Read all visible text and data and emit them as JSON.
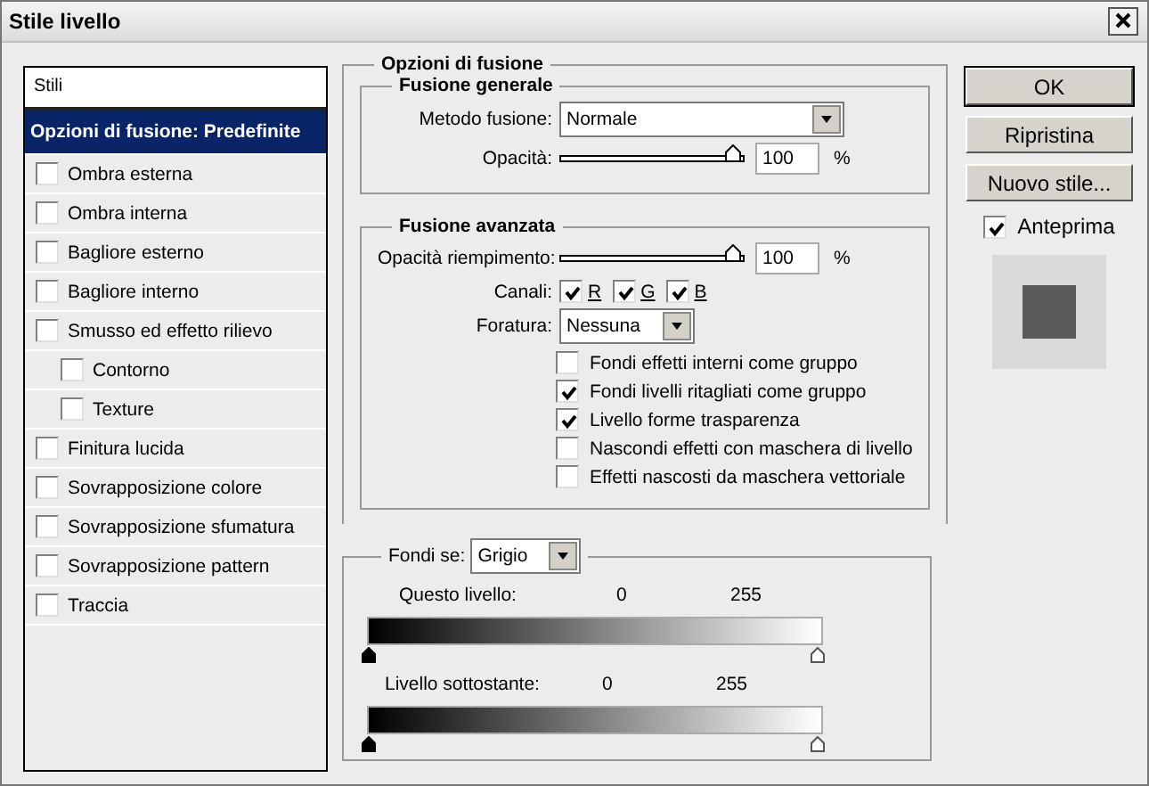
{
  "window": {
    "title": "Stile livello"
  },
  "styles_list": {
    "header": "Stili",
    "items": [
      {
        "label": "Opzioni di fusione: Predefinite",
        "kind": "heading",
        "selected": true
      },
      {
        "label": "Ombra esterna",
        "kind": "check",
        "checked": false,
        "selected": false
      },
      {
        "label": "Ombra interna",
        "kind": "check",
        "checked": false,
        "selected": false
      },
      {
        "label": "Bagliore esterno",
        "kind": "check",
        "checked": false,
        "selected": false
      },
      {
        "label": "Bagliore interno",
        "kind": "check",
        "checked": false,
        "selected": false
      },
      {
        "label": "Smusso ed effetto rilievo",
        "kind": "check",
        "checked": false,
        "selected": false,
        "children": [
          {
            "label": "Contorno",
            "kind": "check",
            "checked": false,
            "selected": false
          },
          {
            "label": "Texture",
            "kind": "check",
            "checked": false,
            "selected": false
          }
        ]
      },
      {
        "label": "Finitura lucida",
        "kind": "check",
        "checked": false,
        "selected": false
      },
      {
        "label": "Sovrapposizione colore",
        "kind": "check",
        "checked": false,
        "selected": false
      },
      {
        "label": "Sovrapposizione sfumatura",
        "kind": "check",
        "checked": false,
        "selected": false
      },
      {
        "label": "Sovrapposizione pattern",
        "kind": "check",
        "checked": false,
        "selected": false
      },
      {
        "label": "Traccia",
        "kind": "check",
        "checked": false,
        "selected": false
      }
    ]
  },
  "blending": {
    "title": "Opzioni di fusione",
    "general": {
      "title": "Fusione generale",
      "mode_label": "Metodo fusione:",
      "mode": "Normale",
      "opacity_label": "Opacità:",
      "opacity": {
        "level": 1,
        "value": "100",
        "unit": "%"
      }
    },
    "advanced": {
      "title": "Fusione avanzata",
      "fill_label": "Opacità riempimento:",
      "fill": {
        "level": 1,
        "value": "100",
        "unit": "%"
      },
      "channels_label": "Canali:",
      "channels": [
        {
          "label": "R",
          "checked": true
        },
        {
          "label": "G",
          "checked": true
        },
        {
          "label": "B",
          "checked": true
        }
      ],
      "knockout_label": "Foratura:",
      "knockout": "Nessuna",
      "options": [
        {
          "label": "Fondi effetti interni come gruppo",
          "checked": false
        },
        {
          "label": "Fondi livelli ritagliati come gruppo",
          "checked": true
        },
        {
          "label": "Livello forme trasparenza",
          "checked": true
        },
        {
          "label": "Nascondi effetti con maschera di livello",
          "checked": false
        },
        {
          "label": "Effetti nascosti da maschera vettoriale",
          "checked": false
        }
      ]
    },
    "blend_if": {
      "label": "Fondi se:",
      "channel": "Grigio",
      "ranges": [
        {
          "label": "Questo livello:",
          "low": "0",
          "high": "255"
        },
        {
          "label": "Livello sottostante:",
          "low": "0",
          "high": "255"
        }
      ]
    }
  },
  "buttons": [
    {
      "label": "OK",
      "default": true
    },
    {
      "label": "Ripristina",
      "default": false
    },
    {
      "label": "Nuovo stile...",
      "default": false
    }
  ],
  "preview": {
    "label": "Anteprima",
    "checked": true
  }
}
